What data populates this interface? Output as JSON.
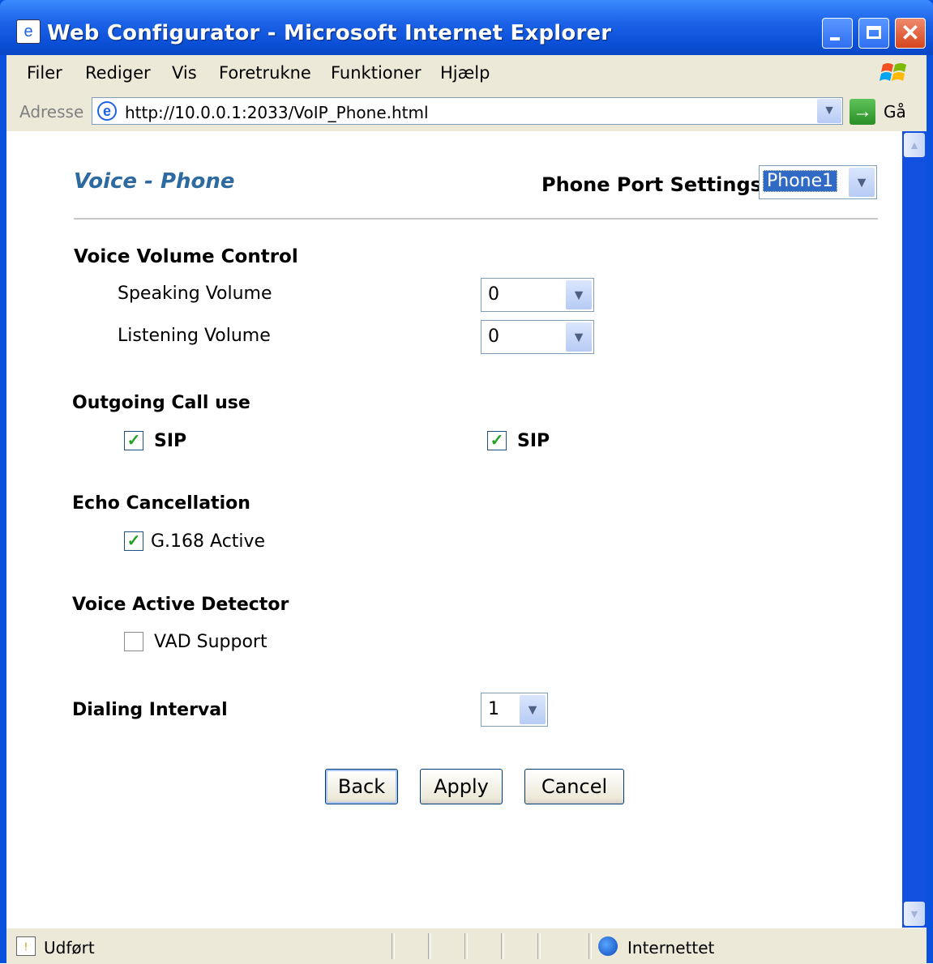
{
  "window": {
    "title": "Web Configurator - Microsoft Internet Explorer",
    "close_glyph": "✕"
  },
  "menubar": {
    "items": [
      "Filer",
      "Rediger",
      "Vis",
      "Foretrukne",
      "Funktioner",
      "Hjælp"
    ]
  },
  "addressbar": {
    "label": "Adresse",
    "url": "http://10.0.0.1:2033/VoIP_Phone.html",
    "go_label": "Gå"
  },
  "page": {
    "title": "Voice - Phone",
    "port_settings_label": "Phone Port Settings:",
    "port_selected": "Phone1",
    "volume": {
      "heading": "Voice Volume Control",
      "speaking_label": "Speaking Volume",
      "speaking_value": "0",
      "listening_label": "Listening Volume",
      "listening_value": "0"
    },
    "outgoing": {
      "heading": "Outgoing Call use",
      "options": [
        {
          "label": "SIP",
          "checked": true
        },
        {
          "label": "SIP",
          "checked": true
        }
      ]
    },
    "echo": {
      "heading": "Echo Cancellation",
      "label": "G.168 Active",
      "checked": true
    },
    "vad": {
      "heading": "Voice Active Detector",
      "label": "VAD Support",
      "checked": false
    },
    "dialing": {
      "heading": "Dialing Interval",
      "value": "1"
    },
    "buttons": {
      "back": "Back",
      "apply": "Apply",
      "cancel": "Cancel"
    }
  },
  "statusbar": {
    "status": "Udført",
    "zone": "Internettet"
  },
  "colors": {
    "title_blue": "#2d6a9f",
    "xp_blue": "#0a52dd",
    "check_green": "#21a121"
  }
}
